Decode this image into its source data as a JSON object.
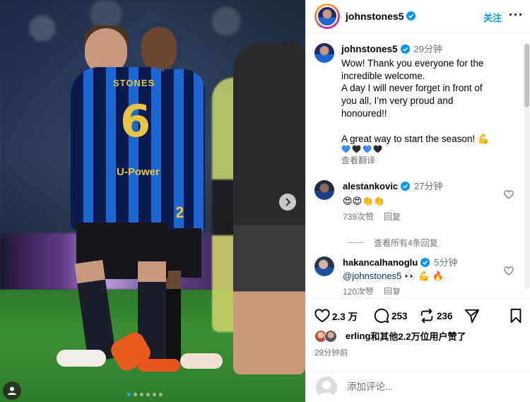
{
  "photo": {
    "jersey_name": "STONES",
    "jersey_number": "6",
    "sponsor": "U-Power",
    "player2_number": "2",
    "carousel_total": 6,
    "carousel_active": 1
  },
  "header": {
    "username": "johnstones5",
    "follow_label": "关注",
    "more_label": "···"
  },
  "post": {
    "username": "johnstones5",
    "time": "29分钟",
    "caption": "Wow! Thank you everyone for the\nincredible welcome.\nA day I will never forget in front of\nyou all, I’m very proud and\nhonoured!!\n\nA great way to start the season! 💪",
    "hearts": [
      "blue-heart",
      "black-heart",
      "blue-heart",
      "black-heart"
    ],
    "translate_label": "查看翻译"
  },
  "comments": [
    {
      "username": "alestankovic",
      "time": "27分钟",
      "text": "😍😍👏👏",
      "likes": "739次赞",
      "reply_label": "回复",
      "view_replies": "查看所有4条回复"
    },
    {
      "username": "hakancalhanoglu",
      "time": "5分钟",
      "mention": "@johnstones5",
      "text": "👀 💪 🔥",
      "likes": "120次赞",
      "reply_label": "回复"
    }
  ],
  "actions": {
    "likes_count": "2.3 万",
    "comments_count": "253",
    "reposts_count": "236"
  },
  "liked_by": {
    "name": "erling",
    "text": "和其他2.2万位用户赞了"
  },
  "post_time": "29分钟前",
  "add_comment": {
    "placeholder": "添加评论..."
  },
  "colors": {
    "link": "#0095f6",
    "verified": "#0095f6",
    "heart_blue": "#3c8ce7",
    "heart_black": "#2b2b2b"
  }
}
